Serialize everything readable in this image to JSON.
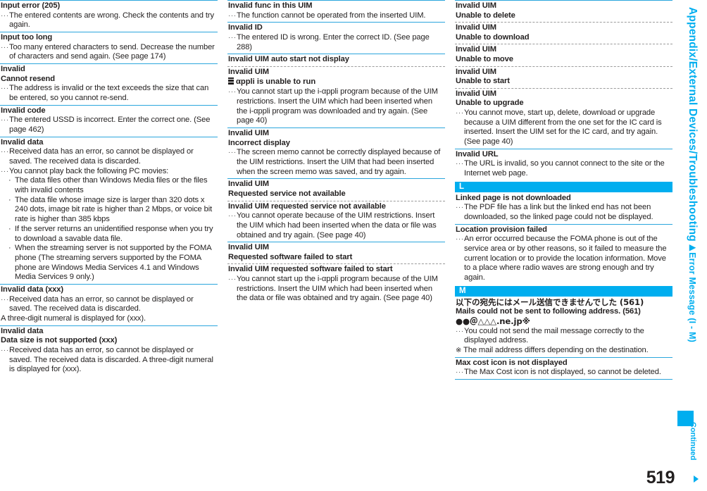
{
  "page": {
    "number": "519",
    "running_head_main": "Appendix/External Devices/Troubleshooting",
    "running_head_sub": "▶Error Message (I - M)",
    "continued_label": "Continued",
    "accent_color": "#00aeef",
    "rule_color": "#2ba6dd",
    "text_color": "#221f1f"
  },
  "columns": [
    {
      "id": "column-1",
      "entries": [
        {
          "terms": [
            "Input error (205)"
          ],
          "blocks": [
            {
              "kind": "desc",
              "text": "The entered contents are wrong. Check the contents and try again."
            }
          ]
        },
        {
          "terms": [
            "Input too long"
          ],
          "blocks": [
            {
              "kind": "desc",
              "text": "Too many entered characters to send. Decrease the number of characters and send again. (See page 174)"
            }
          ]
        },
        {
          "terms": [
            "Invalid",
            "Cannot resend"
          ],
          "blocks": [
            {
              "kind": "desc",
              "text": "The address is invalid or the text exceeds the size that can be entered, so you cannot re-send."
            }
          ]
        },
        {
          "terms": [
            "Invalid code"
          ],
          "blocks": [
            {
              "kind": "desc",
              "text": "The entered USSD is incorrect. Enter the correct one. (See page 462)"
            }
          ]
        },
        {
          "terms": [
            "Invalid data"
          ],
          "blocks": [
            {
              "kind": "desc",
              "text": "Received data has an error, so cannot be displayed or saved. The received data is discarded."
            },
            {
              "kind": "desc",
              "text": "You cannot play back the following PC movies:"
            },
            {
              "kind": "sublist",
              "items": [
                "The data files other than Windows Media files or the files with invalid contents",
                "The data file whose image size is larger than 320 dots x 240 dots, image bit rate is higher than 2 Mbps, or voice bit rate is higher than 385 kbps",
                "If the server returns an unidentified response when you try to download a savable data file.",
                "When the streaming server is not supported by the FOMA phone (The streaming servers supported by the FOMA phone are Windows Media Services 4.1 and Windows Media Services 9 only.)"
              ]
            }
          ]
        },
        {
          "terms": [
            "Invalid data (xxx)"
          ],
          "blocks": [
            {
              "kind": "desc",
              "text": "Received data has an error, so cannot be displayed or saved. The received data is discarded."
            },
            {
              "kind": "desc_cont",
              "text": "A three-digit numeral is displayed for (xxx)."
            }
          ]
        },
        {
          "terms": [
            "Invalid data",
            "Data size is not supported (xxx)"
          ],
          "blocks": [
            {
              "kind": "desc",
              "text": "Received data has an error, so cannot be displayed or saved. The received data is discarded. A three-digit numeral is displayed for (xxx)."
            }
          ]
        }
      ]
    },
    {
      "id": "column-2",
      "entries": [
        {
          "terms": [
            "Invalid func in this UIM"
          ],
          "blocks": [
            {
              "kind": "desc",
              "text": "The function cannot be operated from the inserted UIM."
            }
          ]
        },
        {
          "terms": [
            "Invalid ID"
          ],
          "blocks": [
            {
              "kind": "desc",
              "text": "The entered ID is wrong. Enter the correct ID. (See page 288)"
            }
          ]
        },
        {
          "terms": [
            "Invalid UIM auto start not display"
          ],
          "dashed_after_terms": true,
          "blocks": [
            {
              "kind": "term",
              "text": "Invalid UIM"
            },
            {
              "kind": "appli_term",
              "icon": "i-appli-icon",
              "text": "αppli is unable to run"
            },
            {
              "kind": "desc",
              "text": "You cannot start up the i-αppli program because of the UIM restrictions. Insert the UIM which had been inserted when the i-αppli program was downloaded and try again. (See page 40)"
            }
          ]
        },
        {
          "terms": [
            "Invalid UIM",
            "Incorrect display"
          ],
          "blocks": [
            {
              "kind": "desc",
              "text": "The screen memo cannot be correctly displayed because of the UIM restrictions. Insert the UIM that had been inserted when the screen memo was saved, and try again."
            }
          ]
        },
        {
          "terms": [
            "Invalid UIM",
            "Requested service not available"
          ],
          "dashed_after_terms": true,
          "blocks": [
            {
              "kind": "term",
              "text": "Invalid UIM requested service not available"
            },
            {
              "kind": "desc",
              "text": "You cannot operate because of the UIM restrictions. Insert the UIM which had been inserted when the data or file was obtained and try again. (See page 40)"
            }
          ]
        },
        {
          "terms": [
            "Invalid UIM",
            "Requested software failed to start"
          ],
          "dashed_after_terms": true,
          "blocks": [
            {
              "kind": "term",
              "text": "Invalid UIM requested software failed to start"
            },
            {
              "kind": "desc",
              "text": "You cannot start up the i-αppli program because of the UIM restrictions. Insert the UIM which had been inserted when the data or file was obtained and try again. (See page 40)"
            }
          ]
        }
      ]
    },
    {
      "id": "column-3",
      "entries": [
        {
          "terms": [
            "Invalid UIM",
            "Unable to delete"
          ],
          "dashed_after_terms": true,
          "blocks": [
            {
              "kind": "term",
              "text": "Invalid UIM"
            },
            {
              "kind": "term",
              "text": "Unable to download"
            },
            {
              "kind": "dash"
            },
            {
              "kind": "term",
              "text": "Invalid UIM"
            },
            {
              "kind": "term",
              "text": "Unable to move"
            },
            {
              "kind": "dash"
            },
            {
              "kind": "term",
              "text": "Invalid UIM"
            },
            {
              "kind": "term",
              "text": "Unable to start"
            },
            {
              "kind": "dash"
            },
            {
              "kind": "term",
              "text": "Invalid UIM"
            },
            {
              "kind": "term",
              "text": "Unable to upgrade"
            },
            {
              "kind": "desc",
              "text": "You cannot move, start up, delete, download or upgrade because a UIM different from the one set for the IC card is inserted. Insert the UIM set for the IC card, and try again. (See page 40)"
            }
          ]
        },
        {
          "terms": [
            "Invalid URL"
          ],
          "blocks": [
            {
              "kind": "desc",
              "text": "The URL is invalid, so you cannot connect to the site or the Internet web page."
            }
          ]
        },
        {
          "alpha": "L",
          "terms": [
            "Linked page is not downloaded"
          ],
          "blocks": [
            {
              "kind": "desc",
              "text": "The PDF file has a link but the linked end has not been downloaded, so the linked page could not be displayed."
            }
          ]
        },
        {
          "terms": [
            "Location provision failed"
          ],
          "blocks": [
            {
              "kind": "desc",
              "text": "An error occurred because the FOMA phone is out of the service area or by other reasons, so it failed to measure the current location or to provide the location information. Move to a place where radio waves are strong enough and try again."
            }
          ]
        },
        {
          "alpha": "M",
          "terms": [],
          "blocks": [
            {
              "kind": "term_jp",
              "text": "以下の宛先にはメール送信できませんでした (561)"
            },
            {
              "kind": "term",
              "text": "Mails could not be sent to following address. (561)"
            },
            {
              "kind": "term_jp",
              "text": "●●＠△△△.ne.jp※"
            },
            {
              "kind": "desc",
              "text": "You could not send the mail message correctly to the displayed address."
            },
            {
              "kind": "note",
              "mark": "※",
              "text": "The mail address differs depending on the destination."
            }
          ]
        },
        {
          "terms": [
            "Max cost icon is not displayed"
          ],
          "last": true,
          "blocks": [
            {
              "kind": "desc",
              "text": "The Max Cost icon is not displayed, so cannot be deleted."
            }
          ]
        }
      ]
    }
  ]
}
